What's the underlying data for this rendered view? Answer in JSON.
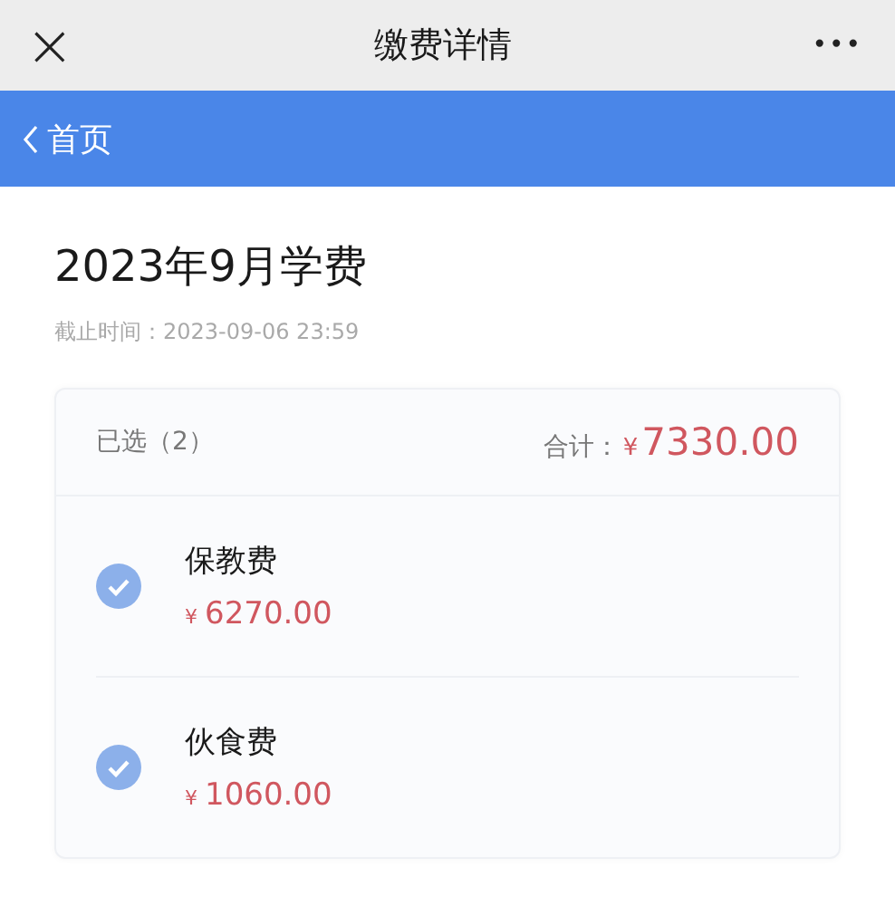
{
  "title_bar": {
    "close": "×",
    "title": "缴费详情",
    "more": "•••"
  },
  "nav_bar": {
    "back_label": "首页"
  },
  "bill": {
    "title": "2023年9月学费",
    "deadline": "截止时间：2023-09-06 23:59"
  },
  "summary": {
    "selected_label": "已选（2）",
    "total_label": "合计：",
    "currency": "¥",
    "total": "7330.00"
  },
  "items": [
    {
      "name": "保教费",
      "currency": "¥",
      "amount": "6270.00",
      "checked": true
    },
    {
      "name": "伙食费",
      "currency": "¥",
      "amount": "1060.00",
      "checked": true
    }
  ]
}
